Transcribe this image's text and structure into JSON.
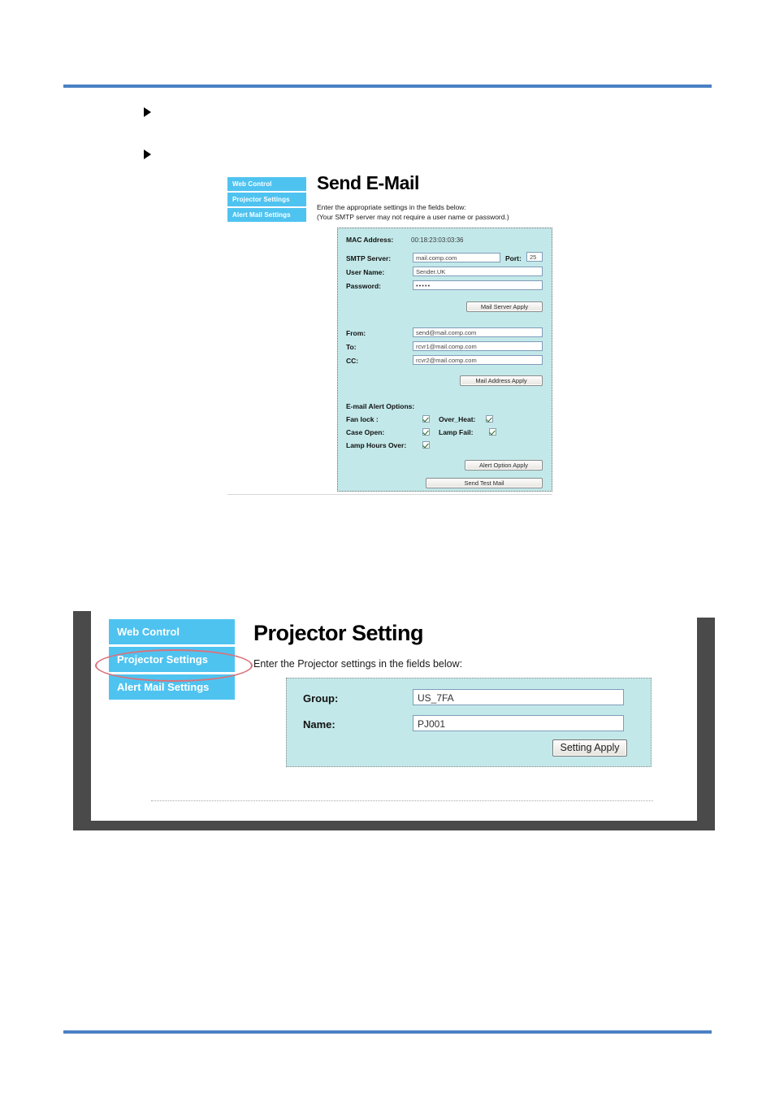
{
  "document": {
    "rules": {
      "color": "#4A81C4"
    },
    "bullets": [
      "",
      ""
    ]
  },
  "email_figure": {
    "nav": {
      "items": [
        {
          "label": "Web Control"
        },
        {
          "label": "Projector Settings"
        },
        {
          "label": "Alert Mail Settings"
        }
      ]
    },
    "title": "Send E-Mail",
    "subtitle_line1": "Enter the appropriate settings in the fields below:",
    "subtitle_line2": "(Your SMTP server may not require a user name or password.)",
    "mac": {
      "label": "MAC Address:",
      "value": "00:18:23:03:03:36"
    },
    "server": {
      "smtp_label": "SMTP Server:",
      "smtp_value": "mail.comp.com",
      "port_label": "Port:",
      "port_value": "25",
      "user_label": "User Name:",
      "user_value": "Sender.UK",
      "password_label": "Password:",
      "password_value": "•••••",
      "apply_label": "Mail Server Apply"
    },
    "addresses": {
      "from_label": "From:",
      "from_value": "send@mail.comp.com",
      "to_label": "To:",
      "to_value": "rcvr1@mail.comp.com",
      "cc_label": "CC:",
      "cc_value": "rcvr2@mail.comp.com",
      "apply_label": "Mail Address Apply"
    },
    "alerts": {
      "heading": "E-mail Alert Options:",
      "fan_lock_label": "Fan lock :",
      "fan_lock_checked": true,
      "over_heat_label": "Over_Heat:",
      "over_heat_checked": true,
      "case_open_label": "Case Open:",
      "case_open_checked": true,
      "lamp_fail_label": "Lamp Fail:",
      "lamp_fail_checked": true,
      "lamp_hours_label": "Lamp Hours Over:",
      "lamp_hours_checked": true,
      "apply_label": "Alert Option Apply",
      "test_label": "Send Test Mail"
    },
    "colors": {
      "nav": "#4FC3F0",
      "panel": "#C3E8E9"
    }
  },
  "projector_figure": {
    "nav": {
      "items": [
        {
          "label": "Web Control"
        },
        {
          "label": "Projector Settings"
        },
        {
          "label": "Alert Mail Settings"
        }
      ],
      "highlighted_index": 1
    },
    "title": "Projector Setting",
    "subtitle": "Enter the Projector settings in the fields below:",
    "form": {
      "group_label": "Group:",
      "group_value": "US_7FA",
      "name_label": "Name:",
      "name_value": "PJ001",
      "apply_label": "Setting Apply"
    },
    "colors": {
      "nav": "#4FC3F0",
      "panel": "#C3E8E9",
      "highlight": "#D9737B",
      "frame": "#4A4A4A"
    }
  }
}
